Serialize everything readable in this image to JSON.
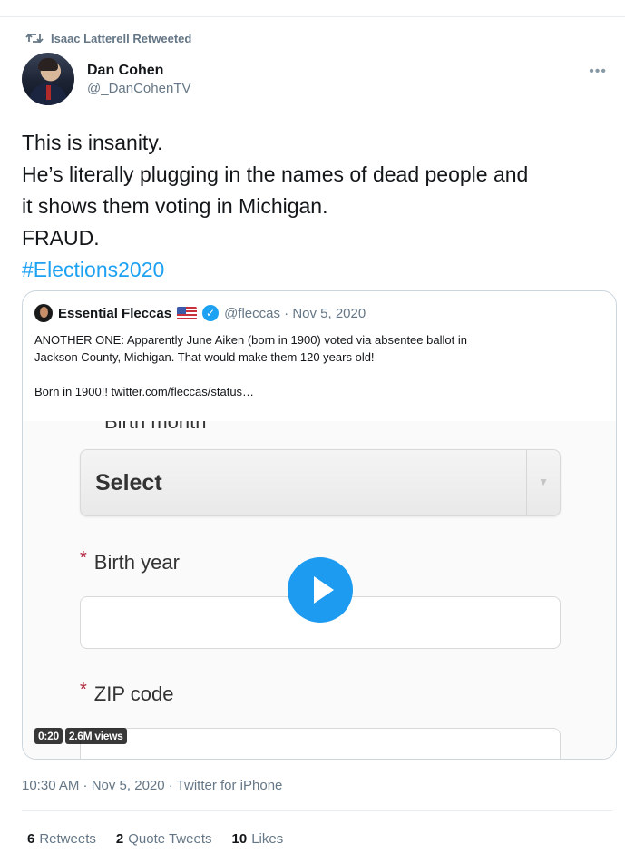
{
  "retweet": {
    "label": "Isaac Latterell Retweeted"
  },
  "author": {
    "name": "Dan Cohen",
    "handle": "@_DanCohenTV"
  },
  "tweet": {
    "lines": [
      "This is insanity.",
      "He’s literally plugging in the names of dead people and",
      "it shows them voting in Michigan.",
      "FRAUD."
    ],
    "hashtag": "#Elections2020"
  },
  "quote": {
    "name": "Essential Fleccas",
    "handle_date": "@fleccas · Nov 5, 2020",
    "text_line1": "ANOTHER ONE: Apparently June Aiken (born in 1900) voted via absentee ballot in",
    "text_line2": "Jackson County, Michigan. That would make them 120 years old!",
    "text_line3": "Born in 1900!!  twitter.com/fleccas/status…",
    "video": {
      "cut_label": "Birth month",
      "select_value": "Select",
      "field1_label": "Birth year",
      "field2_label": "ZIP code",
      "duration": "0:20",
      "views": "2.6M views"
    }
  },
  "meta": {
    "timestamp": "10:30 AM · Nov 5, 2020 · Twitter for iPhone"
  },
  "stats": {
    "retweets_count": "6",
    "retweets_label": "Retweets",
    "quotes_count": "2",
    "quotes_label": "Quote Tweets",
    "likes_count": "10",
    "likes_label": "Likes"
  },
  "colors": {
    "link": "#1da1f2",
    "secondary_text": "#657786",
    "required_star": "#b0243a"
  },
  "icons": [
    "retweet-icon",
    "more-icon",
    "verified-icon",
    "us-flag-icon",
    "play-icon"
  ]
}
